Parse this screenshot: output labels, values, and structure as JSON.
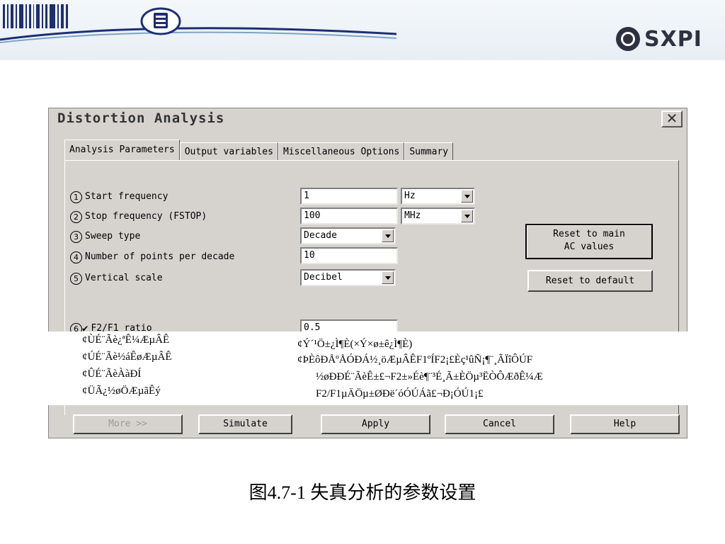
{
  "banner": {
    "brand": "SXPI"
  },
  "dialog": {
    "title": "Distortion Analysis",
    "close_label": "✕",
    "tabs": [
      "Analysis Parameters",
      "Output variables",
      "Miscellaneous Options",
      "Summary"
    ],
    "active_tab": "Analysis Parameters",
    "params": [
      {
        "num": "1",
        "label": "Start frequency",
        "value": "1",
        "unit": "Hz"
      },
      {
        "num": "2",
        "label": "Stop frequency (FSTOP)",
        "value": "100",
        "unit": "MHz"
      },
      {
        "num": "3",
        "label": "Sweep type",
        "value": "Decade"
      },
      {
        "num": "4",
        "label": "Number of points per decade",
        "value": "10"
      },
      {
        "num": "5",
        "label": "Vertical scale",
        "value": "Decibel"
      },
      {
        "num": "6",
        "label": "F2/F1 ratio",
        "value": "0.5",
        "checked": true
      }
    ],
    "reset_main_label": "Reset to main\nAC values",
    "reset_default_label": "Reset to default",
    "buttons": {
      "more": "More >>",
      "simulate": "Simulate",
      "apply": "Apply",
      "cancel": "Cancel",
      "help": "Help"
    }
  },
  "garbled_notes": {
    "left": [
      "¢ÙÉ¨Ãè¿ªÊ¼ÆµÂÊ",
      "¢ÚÉ¨Ãè½áÊøÆµÂÊ",
      "¢ÛÉ¨ÃèÀàÐÍ",
      "¢ÜÃ¿½øÖÆµãÊý"
    ],
    "right": [
      "¢Ý´¹Ö±¿Ì¶È(×Ý×ø±ê¿Ì¶È)",
      "¢ÞÈôÐÅºÅÓÐÁ½¸öÆµÂÊF1ºÍF2¡£Èç¹ûÑ¡¶¨¸ÃÏîÔÚF",
      "½øÐÐÉ¨ÃèÊ±£¬F2±»Éè¶¨³É¸Ã±ÈÖµ³ËÒÔÆðÊ¼Æ",
      "F2/F1µÄÖµ±ØÐë´óÓÚÁã£¬Ð¡ÓÚ1¡£"
    ]
  },
  "caption": "图4.7-1  失真分析的参数设置"
}
